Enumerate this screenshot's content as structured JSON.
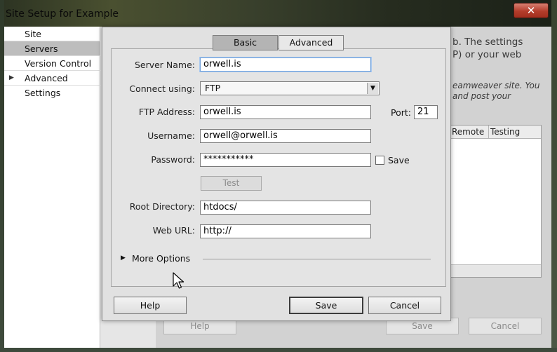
{
  "window": {
    "title": "Site Setup for Example",
    "close_glyph": "✕"
  },
  "sidebar": {
    "items": [
      {
        "label": "Site",
        "selected": false
      },
      {
        "label": "Servers",
        "selected": true
      },
      {
        "label": "Version Control",
        "selected": false
      },
      {
        "label": "Advanced Settings",
        "selected": false,
        "expander": "▶"
      }
    ]
  },
  "background": {
    "text_line1": "b. The settings",
    "text_line2": "P) or your web",
    "italic_line1": "eamweaver site. You",
    "italic_line2": "and post your",
    "table_headers": [
      "Remote",
      "Testing"
    ],
    "help_label": "Help",
    "save_label": "Save",
    "cancel_label": "Cancel"
  },
  "dialog": {
    "tabs": {
      "basic": "Basic",
      "advanced": "Advanced"
    },
    "server_name": {
      "label": "Server Name:",
      "value": "orwell.is"
    },
    "connect_using": {
      "label": "Connect using:",
      "value": "FTP",
      "arrow_glyph": "▼"
    },
    "ftp_address": {
      "label": "FTP Address:",
      "value": "orwell.is"
    },
    "port": {
      "label": "Port:",
      "value": "21"
    },
    "username": {
      "label": "Username:",
      "value": "orwell@orwell.is"
    },
    "password": {
      "label": "Password:",
      "value": "***********"
    },
    "save_password_label": "Save",
    "test_label": "Test",
    "root_directory": {
      "label": "Root Directory:",
      "value": "htdocs/"
    },
    "web_url": {
      "label": "Web URL:",
      "value": "http://"
    },
    "more_options": {
      "label": "More Options",
      "glyph": "▶"
    },
    "buttons": {
      "help": "Help",
      "save": "Save",
      "cancel": "Cancel"
    }
  }
}
